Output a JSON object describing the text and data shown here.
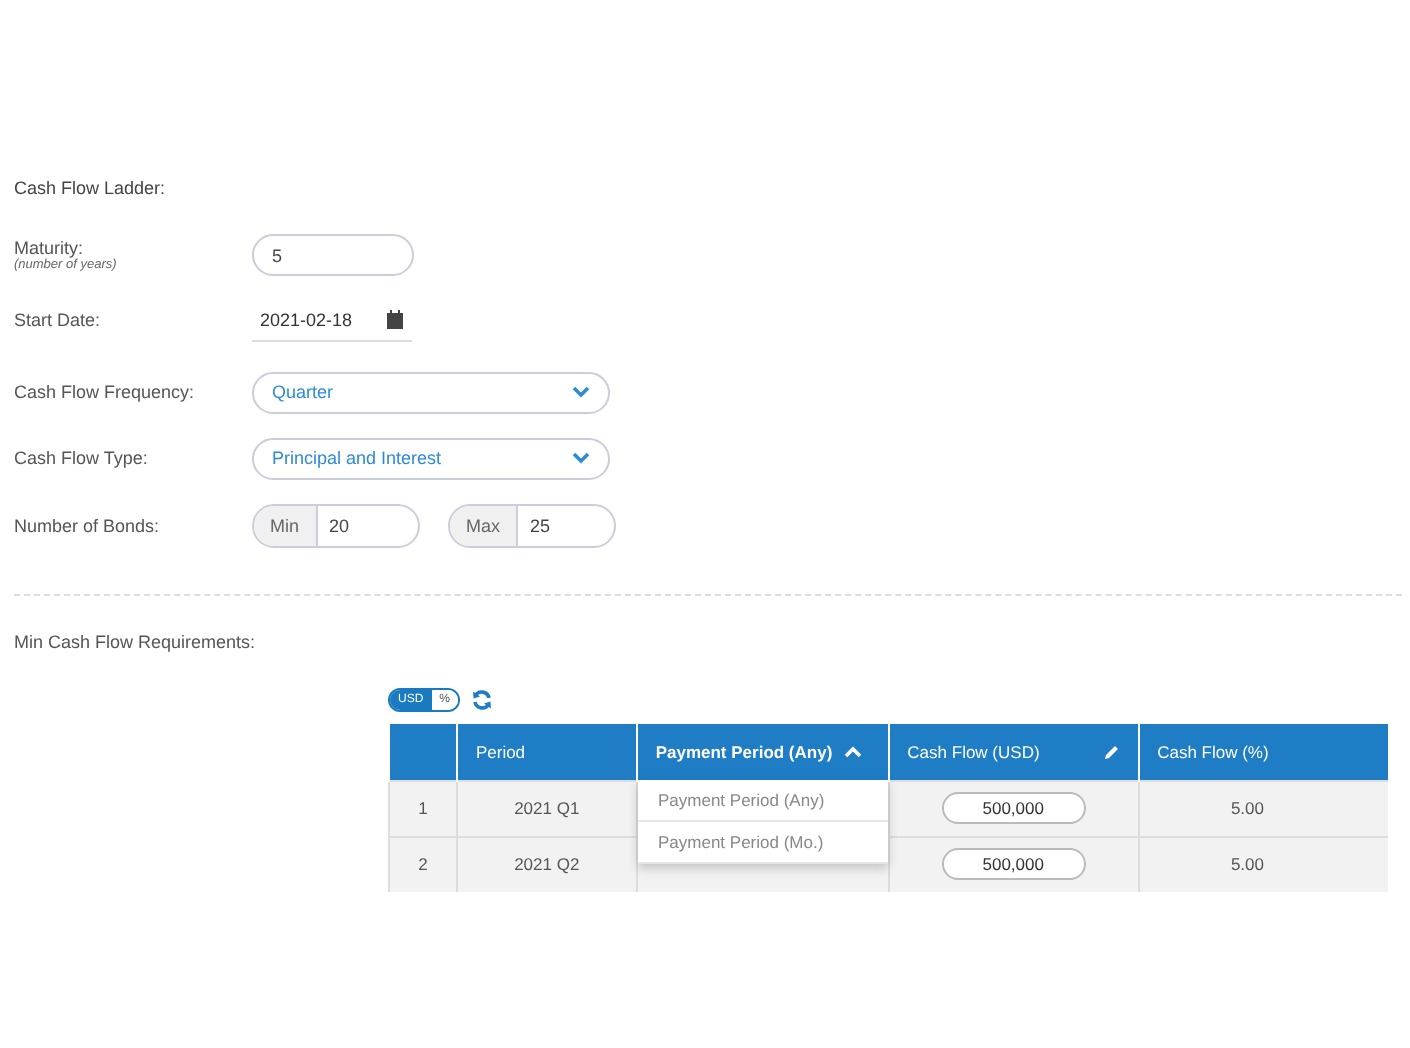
{
  "title": "Cash Flow Ladder:",
  "maturity": {
    "label": "Maturity:",
    "hint": "(number of years)",
    "value": "5"
  },
  "start_date": {
    "label": "Start Date:",
    "value": "2021-02-18"
  },
  "frequency": {
    "label": "Cash Flow Frequency:",
    "value": "Quarter"
  },
  "type": {
    "label": "Cash Flow Type:",
    "value": "Principal and Interest"
  },
  "bonds": {
    "label": "Number of Bonds:",
    "min_label": "Min",
    "min": "20",
    "max_label": "Max",
    "max": "25"
  },
  "requirements": {
    "label": "Min Cash Flow Requirements:",
    "units": [
      {
        "label": "USD",
        "selected": true
      },
      {
        "label": "%",
        "selected": false
      }
    ],
    "columns": [
      "",
      "Period",
      "Payment Period (Any)",
      "Cash Flow (USD)",
      "Cash Flow (%)"
    ],
    "rows": [
      {
        "index": "1",
        "period": "2021 Q1",
        "cash_flow": "500,000",
        "percent": "5.00"
      },
      {
        "index": "2",
        "period": "2021 Q2",
        "cash_flow": "500,000",
        "percent": "5.00"
      }
    ],
    "dropdown": {
      "expanded": true,
      "options": [
        "Payment Period (Any)",
        "Payment Period (Mo.)"
      ]
    }
  }
}
